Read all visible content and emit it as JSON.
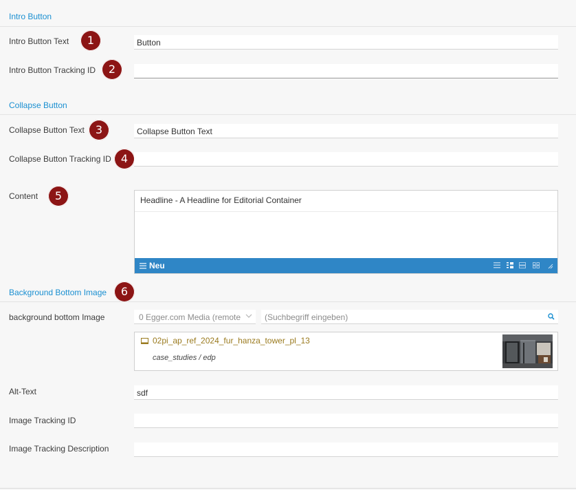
{
  "sections": {
    "intro": "Intro Button",
    "collapse": "Collapse Button",
    "background": "Background Bottom Image"
  },
  "fields": {
    "intro_text": {
      "label": "Intro Button Text",
      "value": "Button"
    },
    "intro_tracking": {
      "label": "Intro Button Tracking ID",
      "value": ""
    },
    "collapse_text": {
      "label": "Collapse Button Text",
      "value": "Collapse Button Text"
    },
    "collapse_tracking": {
      "label": "Collapse Button Tracking ID",
      "value": ""
    },
    "content": {
      "label": "Content",
      "value": "Headline - A Headline for Editorial Container",
      "new_label": "Neu"
    },
    "bg_image": {
      "label": "background bottom Image",
      "source": "0 Egger.com Media (remote",
      "search_placeholder": "(Suchbegriff eingeben)"
    },
    "asset": {
      "title": "02pi_ap_ref_2024_fur_hanza_tower_pl_13",
      "path": "case_studies / edp"
    },
    "alt_text": {
      "label": "Alt-Text",
      "value": "sdf"
    },
    "image_tracking": {
      "label": "Image Tracking ID",
      "value": ""
    },
    "image_tracking_desc": {
      "label": "Image Tracking Description",
      "value": ""
    }
  },
  "badges": [
    "1",
    "2",
    "3",
    "4",
    "5",
    "6"
  ],
  "colors": {
    "accent": "#1a8fd1",
    "badge": "#8c1515",
    "toolbar": "#2f86c6",
    "asset_title": "#9a7a1e"
  }
}
